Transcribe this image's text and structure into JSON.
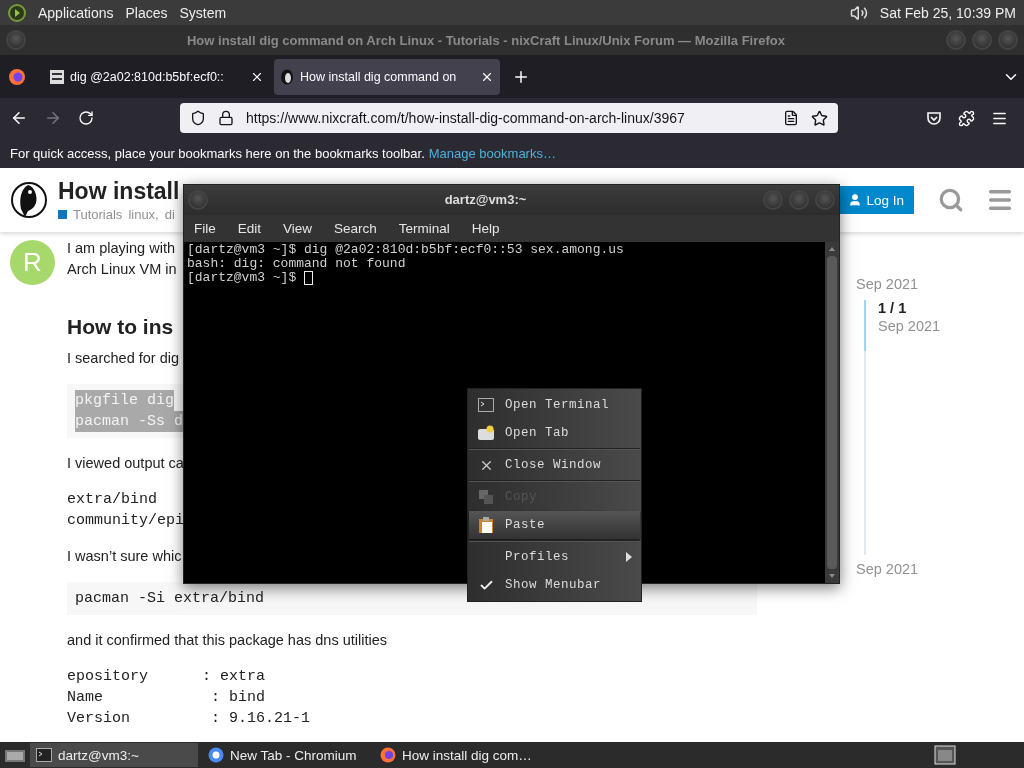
{
  "top_panel": {
    "menus": [
      "Applications",
      "Places",
      "System"
    ],
    "clock": "Sat Feb 25, 10:39 PM"
  },
  "browser": {
    "title": "How install dig command on Arch Linux - Tutorials - nixCraft Linux/Unix Forum — Mozilla Firefox",
    "tabs": [
      {
        "label": "dig @2a02:810d:b5bf:ecf0::",
        "selected": false
      },
      {
        "label": "How install dig command on",
        "selected": true
      }
    ],
    "url": "https://www.nixcraft.com/t/how-install-dig-command-on-arch-linux/3967",
    "bookmarks_hint": "For quick access, place your bookmarks here on the bookmarks toolbar.",
    "bookmarks_link": "Manage bookmarks…"
  },
  "forum": {
    "title": "How install",
    "category": "Tutorials",
    "tags": [
      "linux,",
      "di"
    ],
    "login": "Log In",
    "avatar": "R",
    "blocks": [
      {
        "kind": "text",
        "lines": [
          "I am playing with",
          "Arch Linux VM in"
        ]
      },
      {
        "kind": "heading",
        "lines": [
          "How to ins"
        ]
      },
      {
        "kind": "text",
        "lines": [
          "I searched for dig"
        ]
      },
      {
        "kind": "code",
        "selected": true,
        "lines": [
          "pkgfile dig",
          "pacman -Ss d"
        ]
      },
      {
        "kind": "text",
        "lines": [
          "I viewed output ca"
        ]
      },
      {
        "kind": "mono",
        "lines": [
          "extra/bind",
          "community/epi"
        ]
      },
      {
        "kind": "text",
        "lines": [
          "I wasn’t sure whic"
        ]
      },
      {
        "kind": "code",
        "selected": false,
        "lines": [
          "pacman -Si extra/bind"
        ]
      },
      {
        "kind": "text",
        "lines": [
          "and it confirmed that this package has dns utilities"
        ]
      },
      {
        "kind": "mono",
        "lines": [
          "epository      : extra",
          "Name            : bind",
          "Version         : 9.16.21-1"
        ]
      }
    ],
    "timeline": {
      "start": "Sep 2021",
      "position": "1 / 1",
      "position_date": "Sep 2021",
      "end": "Sep 2021",
      "level": 0.2
    }
  },
  "terminal": {
    "title": "dartz@vm3:~",
    "menus": [
      "File",
      "Edit",
      "View",
      "Search",
      "Terminal",
      "Help"
    ],
    "lines": [
      "[dartz@vm3 ~]$ dig @2a02:810d:b5bf:ecf0::53 sex.among.us",
      "bash: dig: command not found"
    ],
    "prompt": "[dartz@vm3 ~]$ "
  },
  "context_menu": [
    {
      "kind": "action",
      "label": "Open Terminal",
      "disabled": false,
      "selected": false
    },
    {
      "kind": "action",
      "label": "Open Tab",
      "disabled": false,
      "selected": false
    },
    {
      "kind": "separator"
    },
    {
      "kind": "action",
      "label": "Close Window",
      "disabled": false,
      "selected": false
    },
    {
      "kind": "separator"
    },
    {
      "kind": "action",
      "label": "Copy",
      "disabled": true,
      "selected": false
    },
    {
      "kind": "action",
      "label": "Paste",
      "disabled": false,
      "selected": true
    },
    {
      "kind": "separator"
    },
    {
      "kind": "submenu",
      "label": "Profiles",
      "disabled": false,
      "selected": false
    },
    {
      "kind": "check",
      "label": "Show Menubar",
      "checked": true,
      "disabled": false,
      "selected": false
    }
  ],
  "taskbar": [
    {
      "label": "dartz@vm3:~",
      "selected": true
    },
    {
      "label": "New Tab - Chromium",
      "selected": false
    },
    {
      "label": "How install dig com…",
      "selected": false
    }
  ]
}
